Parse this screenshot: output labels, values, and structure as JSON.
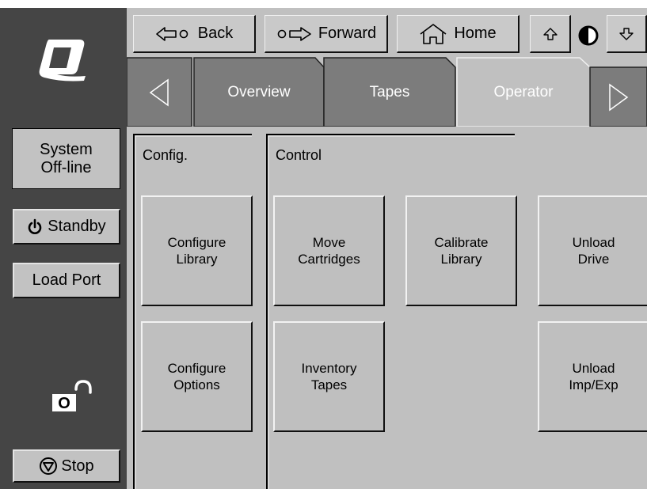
{
  "nav": {
    "back_label": "Back",
    "forward_label": "Forward",
    "home_label": "Home",
    "back_icon": "back-arrow-icon",
    "forward_icon": "forward-arrow-icon",
    "home_icon": "house-icon",
    "scroll_up_icon": "up-arrow-icon",
    "contrast_icon": "contrast-icon",
    "scroll_down_icon": "down-arrow-icon"
  },
  "tabs": {
    "prev_icon": "left-triangle-icon",
    "next_icon": "right-triangle-icon",
    "items": [
      {
        "label": "Overview",
        "active": false
      },
      {
        "label": "Tapes",
        "active": false
      },
      {
        "label": "Operator",
        "active": true
      }
    ]
  },
  "sidebar": {
    "logo_icon": "quantum-q-logo",
    "status": "System\nOff-line",
    "standby_label": "Standby",
    "load_port_label": "Load Port",
    "lock_label": "O",
    "lock_icon": "unlocked-padlock-icon",
    "stop_label": "Stop",
    "stop_icon": "stop-icon",
    "power_icon": "power-icon"
  },
  "sections": {
    "config_title": "Config.",
    "control_title": "Control"
  },
  "buttons": {
    "configure_library": "Configure\nLibrary",
    "configure_options": "Configure\nOptions",
    "move_cartridges": "Move\nCartridges",
    "calibrate_library": "Calibrate\nLibrary",
    "unload_drive": "Unload\nDrive",
    "inventory_tapes": "Inventory\nTapes",
    "unload_impexp": "Unload\nImp/Exp"
  },
  "colors": {
    "sidebar": "#454545",
    "panel": "#c0c0c0",
    "tab_inactive": "#808080",
    "tab_active": "#c0c0c0",
    "tab_text": "#ffffff"
  }
}
